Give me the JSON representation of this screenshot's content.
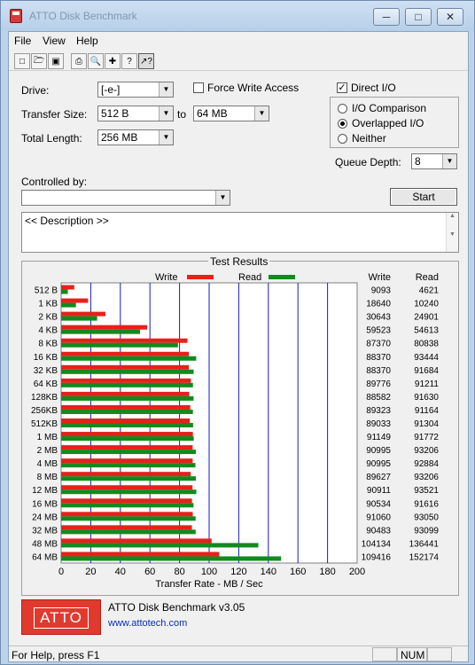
{
  "window": {
    "title": "ATTO Disk Benchmark"
  },
  "menu": [
    "File",
    "View",
    "Help"
  ],
  "settings": {
    "drive_label": "Drive:",
    "drive_value": "[-e-]",
    "transfer_size_label": "Transfer Size:",
    "transfer_from": "512 B",
    "to_label": "to",
    "transfer_to": "64 MB",
    "total_length_label": "Total Length:",
    "total_length": "256 MB",
    "force_write_label": "Force Write Access",
    "force_write": false,
    "direct_io_label": "Direct I/O",
    "direct_io": true,
    "io_options": [
      "I/O Comparison",
      "Overlapped I/O",
      "Neither"
    ],
    "io_selected": 1,
    "queue_depth_label": "Queue Depth:",
    "queue_depth": "8",
    "controlled_by_label": "Controlled by:",
    "controlled_by": "",
    "start_label": "Start"
  },
  "description": "<< Description >>",
  "results": {
    "title": "Test Results",
    "write_label": "Write",
    "read_label": "Read",
    "col_write": "Write",
    "col_read": "Read"
  },
  "chart_data": {
    "type": "bar",
    "categories": [
      "512 B",
      "1 KB",
      "2 KB",
      "4 KB",
      "8 KB",
      "16 KB",
      "32 KB",
      "64 KB",
      "128KB",
      "256KB",
      "512KB",
      "1 MB",
      "2 MB",
      "4 MB",
      "8 MB",
      "12 MB",
      "16 MB",
      "24 MB",
      "32 MB",
      "48 MB",
      "64 MB"
    ],
    "series": [
      {
        "name": "Write",
        "color": "#e8201c",
        "values": [
          9093,
          18640,
          30643,
          59523,
          87370,
          88370,
          88370,
          89776,
          88582,
          89323,
          89033,
          91149,
          90995,
          90995,
          89627,
          90911,
          90534,
          91060,
          90483,
          104134,
          109416
        ]
      },
      {
        "name": "Read",
        "color": "#118a1e",
        "values": [
          4621,
          10240,
          24901,
          54613,
          80838,
          93444,
          91684,
          91211,
          91630,
          91164,
          91304,
          91772,
          93206,
          92884,
          93206,
          93521,
          91616,
          93050,
          93099,
          136441,
          152174
        ]
      }
    ],
    "xlabel": "Transfer Rate - MB / Sec",
    "xlim": [
      0,
      200
    ],
    "xticks": [
      0,
      20,
      40,
      60,
      80,
      100,
      120,
      140,
      160,
      180,
      200
    ],
    "grid": true
  },
  "footer": {
    "product": "ATTO Disk Benchmark v3.05",
    "website": "www.attotech.com",
    "logo_text": "ATTO"
  },
  "status": {
    "text": "For Help, press F1",
    "num": "NUM"
  }
}
